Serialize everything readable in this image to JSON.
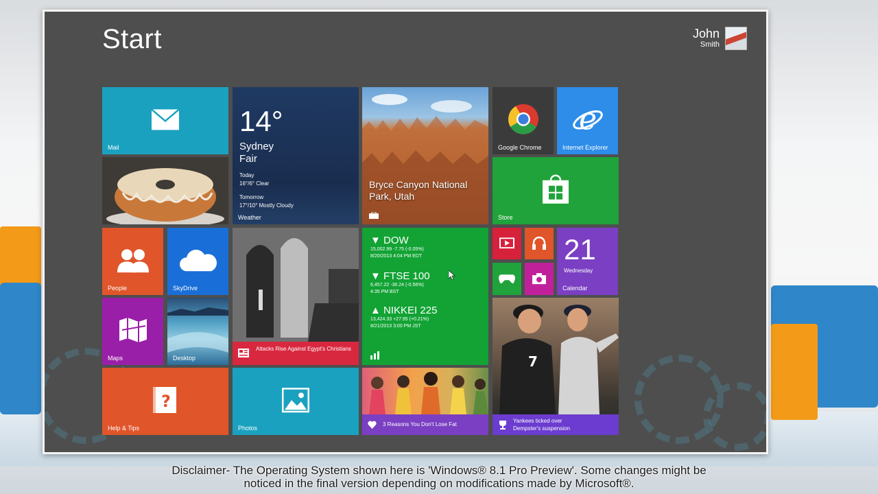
{
  "start": {
    "title": "Start"
  },
  "user": {
    "first_name": "John",
    "last_name": "Smith"
  },
  "tiles": {
    "mail": {
      "label": "Mail",
      "icon": "mail-icon"
    },
    "weather": {
      "temp": "14°",
      "city": "Sydney",
      "condition": "Fair",
      "today_label": "Today",
      "today_forecast": "16°/6° Clear",
      "tomorrow_label": "Tomorrow",
      "tomorrow_forecast": "17°/10° Mostly Cloudy",
      "label": "Weather"
    },
    "travel": {
      "caption": "Bryce Canyon National Park, Utah"
    },
    "chrome": {
      "label": "Google Chrome",
      "icon": "chrome-icon"
    },
    "ie": {
      "label": "Internet Explorer",
      "icon": "ie-icon"
    },
    "store": {
      "label": "Store",
      "icon": "store-icon"
    },
    "people": {
      "label": "People",
      "icon": "people-icon"
    },
    "skydrive": {
      "label": "SkyDrive",
      "icon": "cloud-icon"
    },
    "maps": {
      "label": "Maps",
      "icon": "map-icon"
    },
    "desktop": {
      "label": "Desktop"
    },
    "news": {
      "headline": "Attacks Rise Against Egypt's Christians"
    },
    "finance": {
      "dow_name": "DOW",
      "dow_value": "15,002.99 -7.75 (-0.05%)",
      "dow_time": "8/20/2013 4:04 PM EDT",
      "ftse_name": "FTSE 100",
      "ftse_value": "6,457.22 -36.24 (-0.56%)",
      "ftse_time": "4:35 PM BST",
      "nikkei_name": "NIKKEI 225",
      "nikkei_value": "13,424.33 +27.95 (+0.21%)",
      "nikkei_time": "8/21/2013 3:00 PM JST"
    },
    "calendar": {
      "day": "21",
      "weekday": "Wednesday",
      "label": "Calendar"
    },
    "sport": {
      "headline": "Yankees ticked over Dempster's suspension"
    },
    "help": {
      "label": "Help & Tips",
      "icon": "help-icon"
    },
    "photos": {
      "label": "Photos",
      "icon": "photos-icon"
    },
    "health": {
      "headline": "3 Reasons You Don't Lose Fat"
    }
  },
  "disclaimer": {
    "line1": "Disclaimer- The Operating System shown here is 'Windows® 8.1 Pro Preview'. Some changes might be",
    "line2": "noticed in the final version depending on modifications made by Microsoft®."
  },
  "colors": {
    "start_bg": "#4e4e4e",
    "mail": "#1ba1c0",
    "store": "#1fa33a",
    "ie": "#2d8de8",
    "people": "#e0552a",
    "maps": "#9a1fa8",
    "calendar": "#7a3fc2",
    "news_bar": "#d8283f"
  }
}
